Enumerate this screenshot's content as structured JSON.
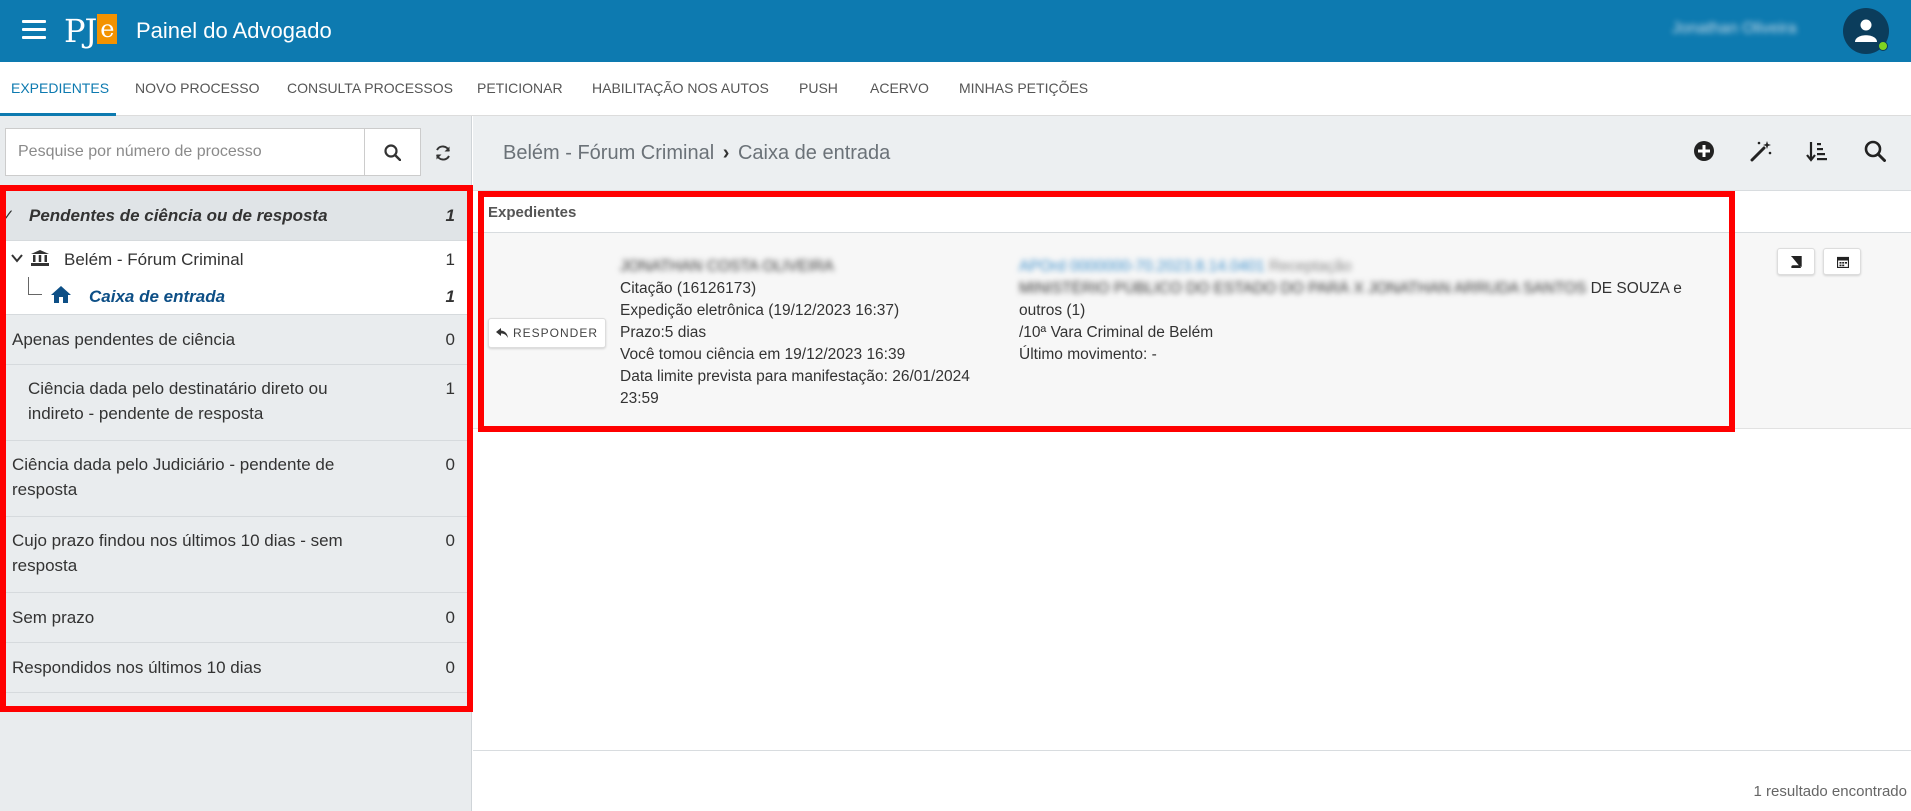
{
  "header": {
    "logo_text": "PJ",
    "logo_e": "e",
    "title": "Painel do Advogado",
    "user_name": "Jonathan Oliveira",
    "colors": {
      "brand": "#0d7ab0",
      "logo_accent": "#f39200",
      "status_online": "#7ed321"
    }
  },
  "nav": {
    "tabs": [
      {
        "label": "EXPEDIENTES",
        "active": true
      },
      {
        "label": "NOVO PROCESSO"
      },
      {
        "label": "CONSULTA PROCESSOS"
      },
      {
        "label": "PETICIONAR"
      },
      {
        "label": "HABILITAÇÃO NOS AUTOS"
      },
      {
        "label": "PUSH"
      },
      {
        "label": "ACERVO"
      },
      {
        "label": "MINHAS PETIÇÕES"
      }
    ]
  },
  "left": {
    "search_placeholder": "Pesquise por número de processo",
    "icons": {
      "search": "search-icon",
      "refresh": "refresh-icon"
    },
    "items": [
      {
        "label": "Pendentes de ciência ou de resposta",
        "count": "1"
      },
      {
        "label": "Belém - Fórum Criminal",
        "count": "1"
      },
      {
        "label": "Caixa de entrada",
        "count": "1"
      },
      {
        "label": "Apenas pendentes de ciência",
        "count": "0"
      },
      {
        "label_line1": "Ciência dada pelo destinatário direto ou",
        "label_line2": "indireto - pendente de resposta",
        "count": "1"
      },
      {
        "label_line1": "Ciência dada pelo Judiciário - pendente de",
        "label_line2": "resposta",
        "count": "0"
      },
      {
        "label_line1": "Cujo prazo findou nos últimos 10 dias - sem",
        "label_line2": "resposta",
        "count": "0"
      },
      {
        "label": "Sem prazo",
        "count": "0"
      },
      {
        "label": "Respondidos nos últimos 10 dias",
        "count": "0"
      }
    ]
  },
  "main": {
    "breadcrumb": {
      "part1": "Belém - Fórum Criminal",
      "separator": "›",
      "part2": "Caixa de entrada"
    },
    "toolbar_icons": [
      "plus-circle-icon",
      "magic-wand-icon",
      "sort-icon",
      "search-icon"
    ],
    "section_title": "Expedientes",
    "respond_label": "RESPONDER",
    "item": {
      "party_name": "JONATHAN COSTA OLIVEIRA",
      "citation": "Citação (16126173)",
      "expedition": "Expedição eletrônica (19/12/2023 16:37)",
      "deadline": "Prazo:5 dias",
      "awareness": "Você tomou ciência em 19/12/2023 16:39",
      "limit_line1": "Data limite prevista para manifestação: 26/01/2024",
      "limit_line2": "23:59",
      "process_number": "APOrd 0000000-70.2023.8.14.0401",
      "process_class": "Receptação",
      "parties_blur": "MINISTÉRIO PÚBLICO DO ESTADO DO PARÁ X JONATHAN ARRUDA SANTOS",
      "parties_tail": " DE SOUZA e",
      "parties_line2": "outros (1)",
      "court": "/10ª Vara Criminal de Belém",
      "last_movement": "Último movimento: -"
    },
    "result_count": "1 resultado encontrado"
  }
}
